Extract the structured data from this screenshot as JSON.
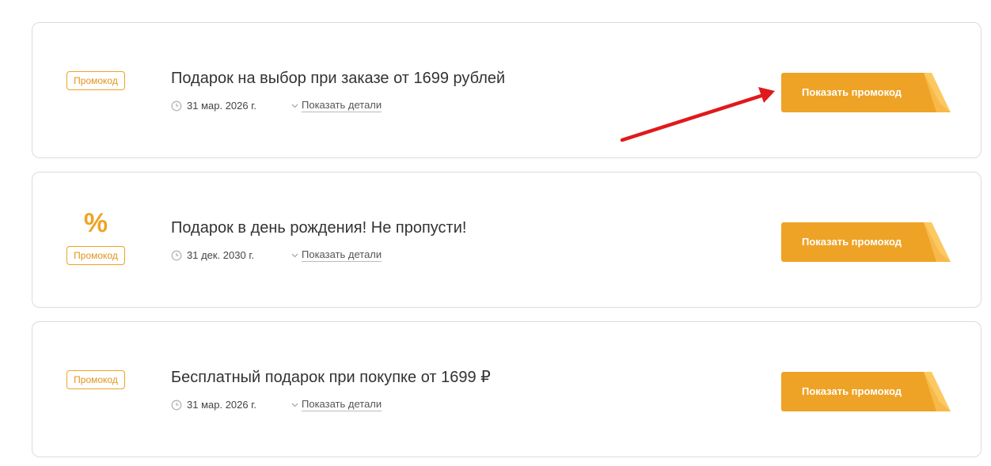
{
  "offers": [
    {
      "badge": "Промокод",
      "title": "Подарок на выбор при заказе от 1699 рублей",
      "date": "31 мар. 2026 г.",
      "details_label": "Показать детали",
      "button_label": "Показать промокод"
    },
    {
      "icon_text": "%",
      "badge": "Промокод",
      "title": "Подарок в день рождения! Не пропусти!",
      "date": "31 дек. 2030 г.",
      "details_label": "Показать детали",
      "button_label": "Показать промокод"
    },
    {
      "badge": "Промокод",
      "title": "Бесплатный подарок при покупке от 1699 ₽",
      "date": "31 мар. 2026 г.",
      "details_label": "Показать детали",
      "button_label": "Показать промокод"
    }
  ],
  "icons": {
    "clock": "clock-icon",
    "chevron": "chevron-down-icon",
    "percent": "percent-icon",
    "annotation": "red-arrow-annotation"
  },
  "colors": {
    "accent": "#eea326",
    "accent_dark": "#e0941c",
    "accent_fold": "#f7b94a",
    "annotation": "#e0191b",
    "border": "#dcdcdc"
  }
}
